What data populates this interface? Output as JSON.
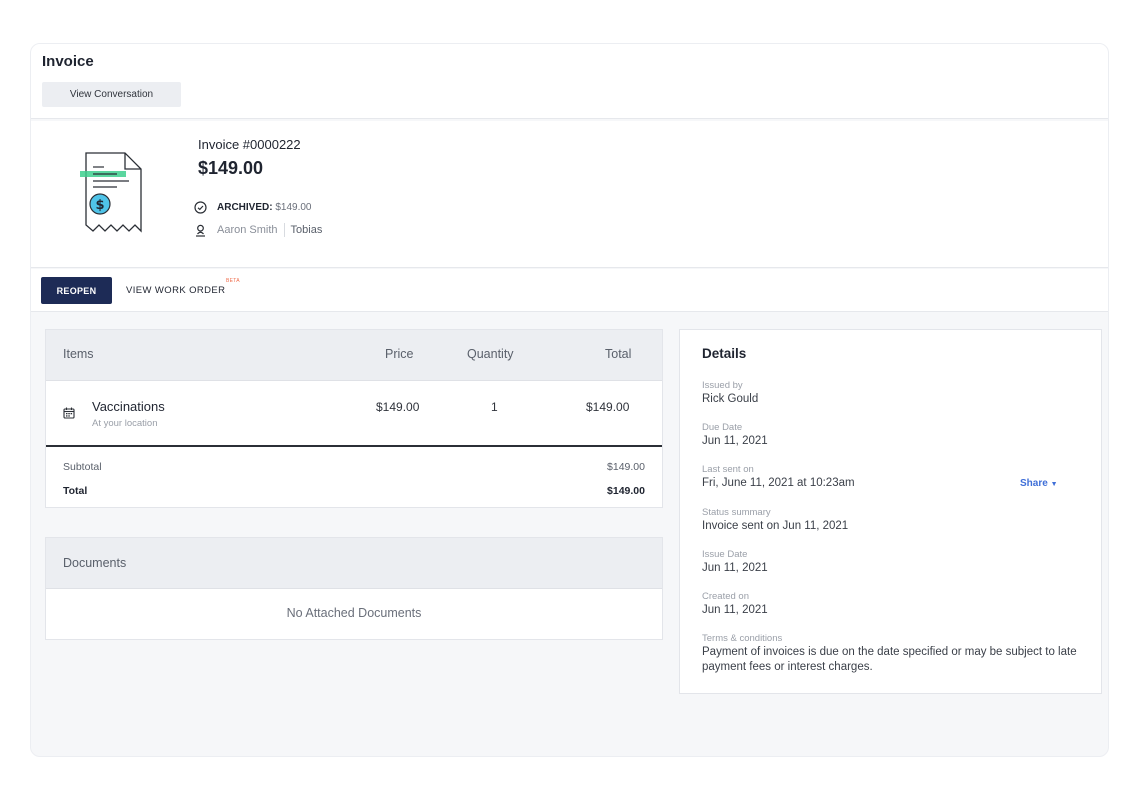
{
  "header": {
    "title": "Invoice",
    "view_conversation_label": "View Conversation"
  },
  "summary": {
    "invoice_number": "Invoice #0000222",
    "amount": "$149.00",
    "status_label": "ARCHIVED:",
    "status_value": "$149.00",
    "client_name": "Aaron Smith",
    "assignee": "Tobias"
  },
  "actions": {
    "reopen_label": "REOPEN",
    "view_work_order_label": "VIEW WORK ORDER",
    "beta_badge": "BETA"
  },
  "items": {
    "columns": {
      "items": "Items",
      "price": "Price",
      "quantity": "Quantity",
      "total": "Total"
    },
    "rows": [
      {
        "name": "Vaccinations",
        "subtitle": "At your location",
        "price": "$149.00",
        "quantity": "1",
        "total": "$149.00",
        "icon": "calendar-icon"
      }
    ],
    "subtotal_label": "Subtotal",
    "subtotal_value": "$149.00",
    "total_label": "Total",
    "total_value": "$149.00"
  },
  "documents": {
    "title": "Documents",
    "empty_text": "No Attached Documents"
  },
  "details": {
    "title": "Details",
    "issued_by_label": "Issued by",
    "issued_by_value": "Rick Gould",
    "due_date_label": "Due Date",
    "due_date_value": "Jun 11, 2021",
    "last_sent_label": "Last sent on",
    "last_sent_value": "Fri, June 11, 2021 at 10:23am",
    "share_label": "Share",
    "status_summary_label": "Status summary",
    "status_summary_value": "Invoice sent on Jun 11, 2021",
    "issue_date_label": "Issue Date",
    "issue_date_value": "Jun 11, 2021",
    "created_on_label": "Created on",
    "created_on_value": "Jun 11, 2021",
    "terms_label": "Terms & conditions",
    "terms_value": "Payment of invoices is due on the date specified or may be subject to late payment fees or interest charges."
  },
  "colors": {
    "primary_button": "#1d2b56",
    "link": "#3f6fd8",
    "beta_badge": "#ef6b4a",
    "illustration_highlight": "#3ecf8e",
    "illustration_coin": "#4fc3e8"
  }
}
